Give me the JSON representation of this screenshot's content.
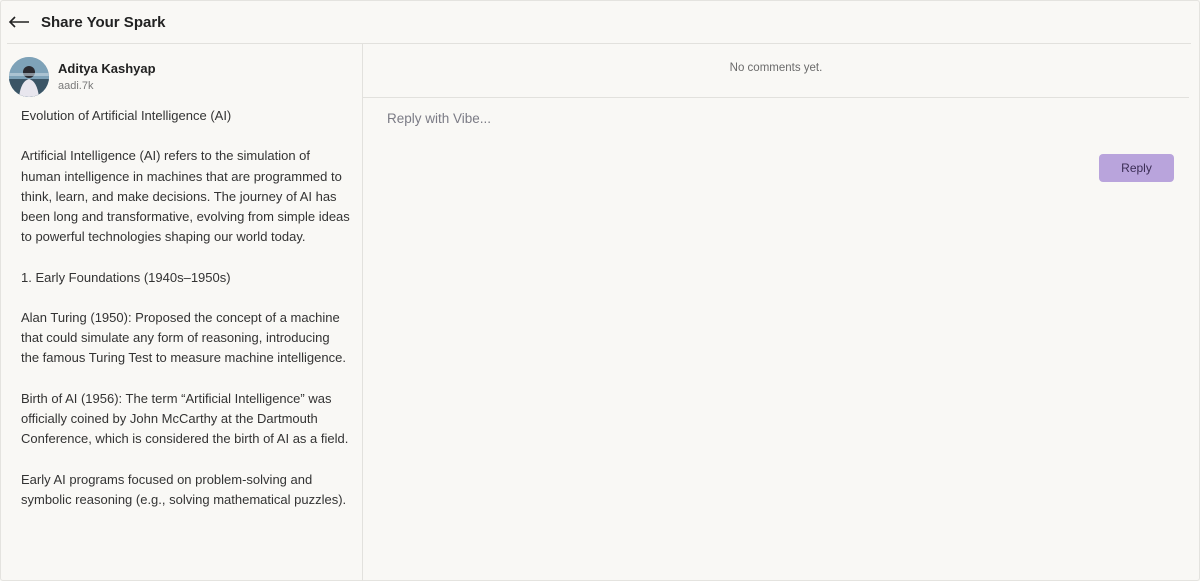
{
  "header": {
    "back_icon": "arrow-left-icon",
    "title": "Share Your Spark"
  },
  "post": {
    "author_name": "Aditya Kashyap",
    "author_handle": "aadi.7k",
    "paragraphs": [
      "Evolution of Artificial Intelligence (AI)",
      "Artificial Intelligence (AI) refers to the simulation of human intelligence in machines that are programmed to think, learn, and make decisions. The journey of AI has been long and transformative, evolving from simple ideas to powerful technologies shaping our world today.",
      "1. Early Foundations (1940s–1950s)",
      "Alan Turing (1950): Proposed the concept of a machine that could simulate any form of reasoning, introducing the famous Turing Test to measure machine intelligence.",
      "Birth of AI (1956): The term “Artificial Intelligence” was officially coined by John McCarthy at the Dartmouth Conference, which is considered the birth of AI as a field.",
      "Early AI programs focused on problem-solving and symbolic reasoning (e.g., solving mathematical puzzles)."
    ]
  },
  "comments": {
    "empty_text": "No comments yet.",
    "reply_placeholder": "Reply with Vibe...",
    "reply_value": "",
    "reply_button_label": "Reply"
  },
  "colors": {
    "accent": "#b9a4dc",
    "background": "#f9f8f5"
  }
}
